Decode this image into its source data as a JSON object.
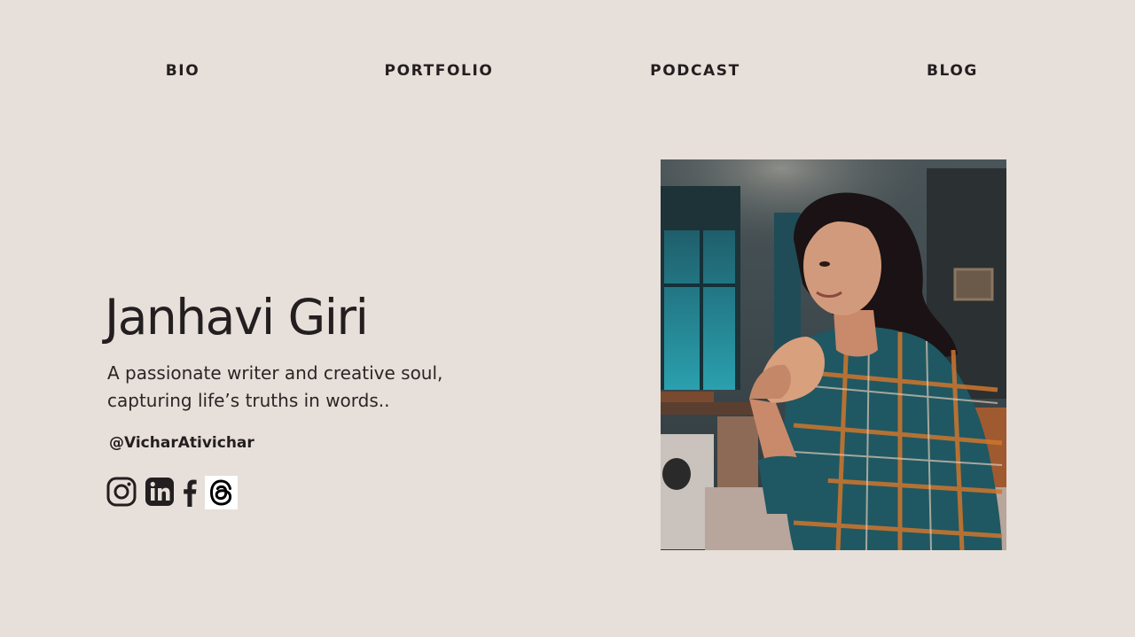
{
  "nav": {
    "items": [
      {
        "label": "BIO"
      },
      {
        "label": "PORTFOLIO"
      },
      {
        "label": "PODCAST"
      },
      {
        "label": "BLOG"
      }
    ]
  },
  "hero": {
    "name": "Janhavi Giri",
    "tagline_line1": "A passionate writer and creative soul,",
    "tagline_line2": "capturing life’s truths in words..",
    "handle": "@VicharAtivichar"
  },
  "socials": [
    {
      "icon": "instagram-icon"
    },
    {
      "icon": "linkedin-icon"
    },
    {
      "icon": "facebook-icon"
    },
    {
      "icon": "threads-icon"
    }
  ],
  "photo": {
    "subject": "portrait photo of woman in plaid shirt seated at cafe table"
  },
  "colors": {
    "background": "#e7dfd9",
    "text": "#231f20"
  }
}
